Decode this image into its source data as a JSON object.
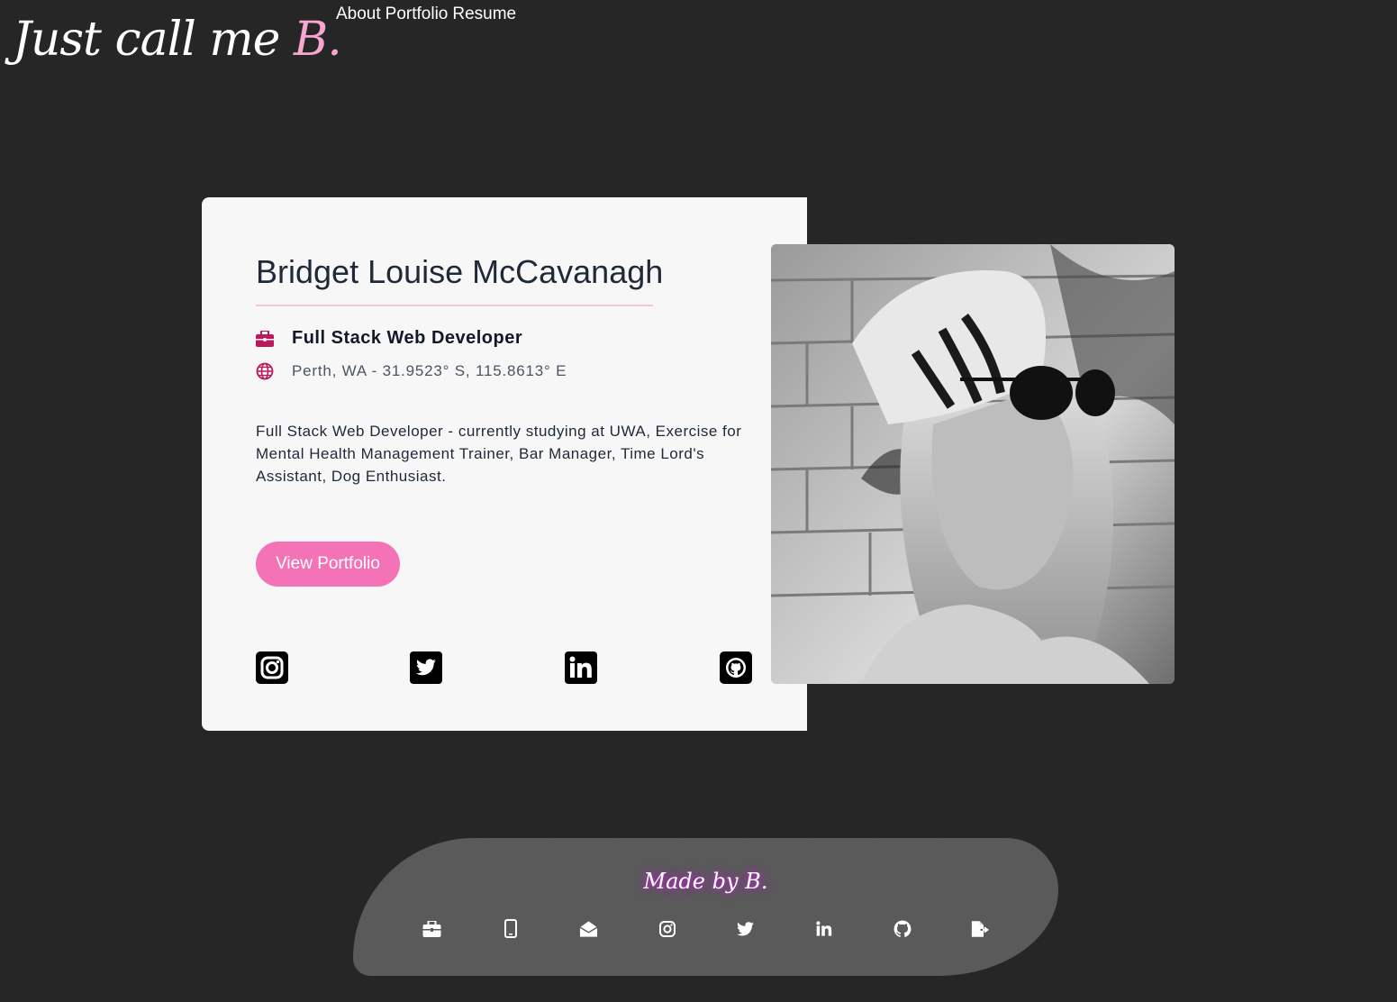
{
  "header": {
    "logo_text": "Just call me ",
    "logo_accent": "B.",
    "nav": [
      "About",
      "Portfolio",
      "Resume"
    ]
  },
  "profile": {
    "name": "Bridget Louise McCavanagh",
    "title": "Full Stack Web Developer",
    "location": "Perth, WA - 31.9523° S, 115.8613° E",
    "bio": "Full Stack Web Developer - currently studying at UWA, Exercise for Mental Health Management Trainer, Bar Manager, Time Lord's Assistant, Dog Enthusiast.",
    "button_label": "View Portfolio",
    "social_icons": [
      "instagram-icon",
      "twitter-icon",
      "linkedin-icon",
      "github-icon"
    ]
  },
  "footer": {
    "tagline": "Made by B.",
    "icons": [
      "briefcase-icon",
      "phone-icon",
      "mail-open-icon",
      "instagram-icon",
      "twitter-icon",
      "linkedin-icon",
      "github-icon",
      "resume-icon"
    ]
  },
  "colors": {
    "background": "#262626",
    "accent_pink": "#f472b6",
    "icon_magenta": "#be185d",
    "footer_bg": "#5a5a5a"
  }
}
